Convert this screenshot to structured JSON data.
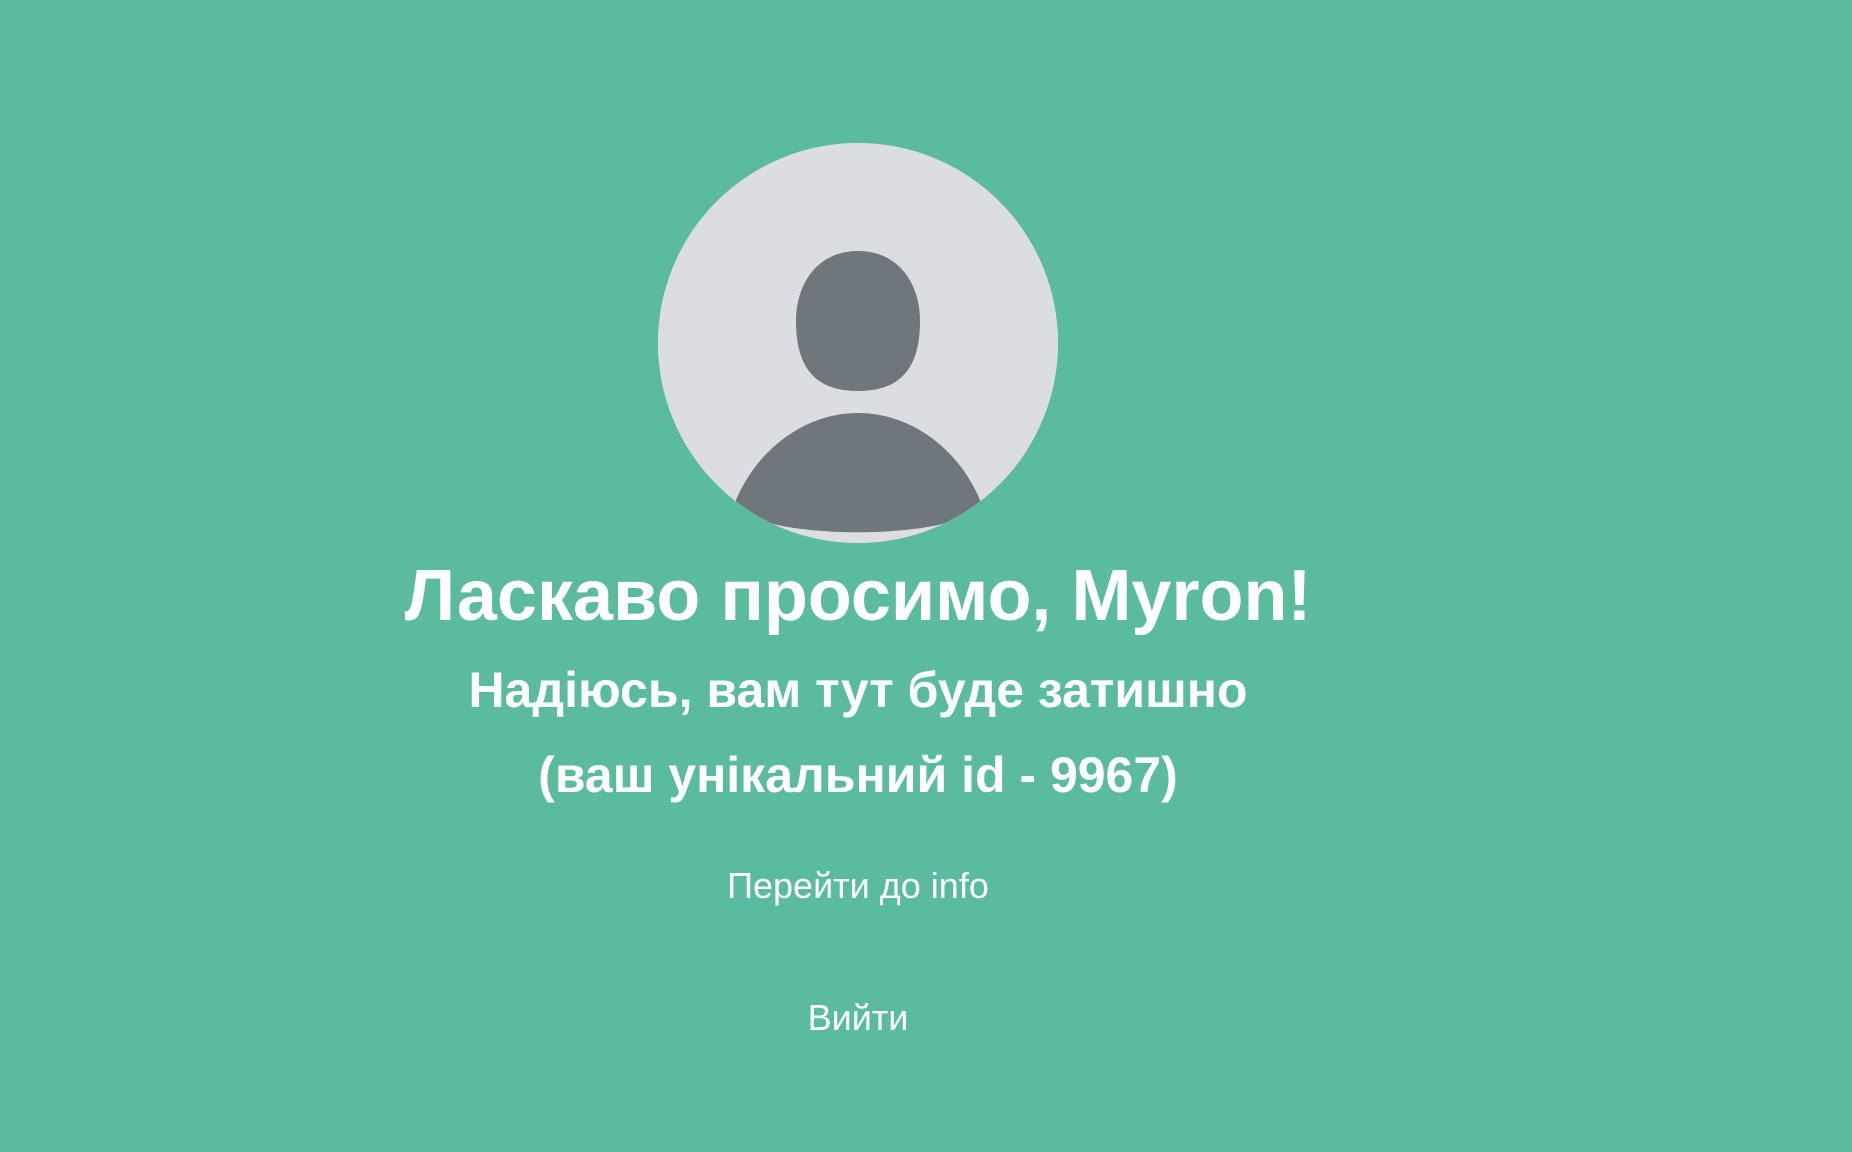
{
  "avatar": {
    "icon": "user-avatar-placeholder-icon",
    "background_color": "#dcdde1",
    "figure_color": "#6f767c"
  },
  "welcome": {
    "title": "Ласкаво просимо, Myron!",
    "subtitle": "Надіюсь, вам тут буде затишно",
    "unique_id": "(ваш унікальний id - 9967)"
  },
  "actions": {
    "info_label": "Перейти до info",
    "logout_label": "Вийти"
  },
  "colors": {
    "page_background": "#5abb9e",
    "text": "#ffffff"
  }
}
